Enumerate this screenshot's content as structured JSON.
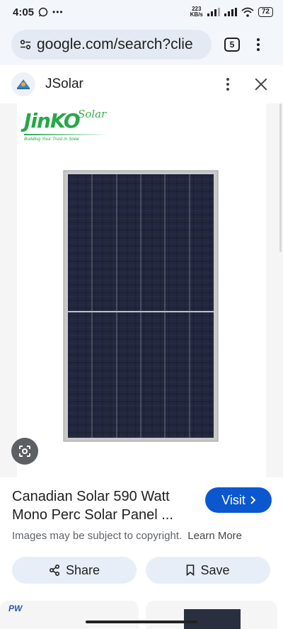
{
  "status_bar": {
    "time": "4:05",
    "speed_value": "223",
    "speed_unit": "KB/s",
    "battery": "72"
  },
  "browser": {
    "url": "google.com/search?clie",
    "tab_count": "5"
  },
  "panel": {
    "site_name": "JSolar"
  },
  "image": {
    "brand_logo": "JinKO",
    "brand_logo_sub": "Solar",
    "brand_tagline": "Building Your Trust in Solar"
  },
  "result": {
    "title": "Canadian Solar 590 Watt Mono Perc Solar Panel ...",
    "visit_label": "Visit",
    "copyright_text": "Images may be subject to copyright.",
    "learn_more_label": "Learn More",
    "share_label": "Share",
    "save_label": "Save"
  },
  "related": {
    "thumb_1_logo": "PW"
  },
  "colors": {
    "accent": "#0b57d0",
    "chip_bg": "#e8eef8",
    "logo_green": "#25a84a"
  },
  "icons": [
    "whatsapp-icon",
    "site-settings-icon",
    "kebab-menu-icon",
    "close-icon",
    "google-lens-icon",
    "share-icon",
    "bookmark-icon",
    "chevron-right-icon",
    "wifi-icon",
    "signal-icon"
  ]
}
